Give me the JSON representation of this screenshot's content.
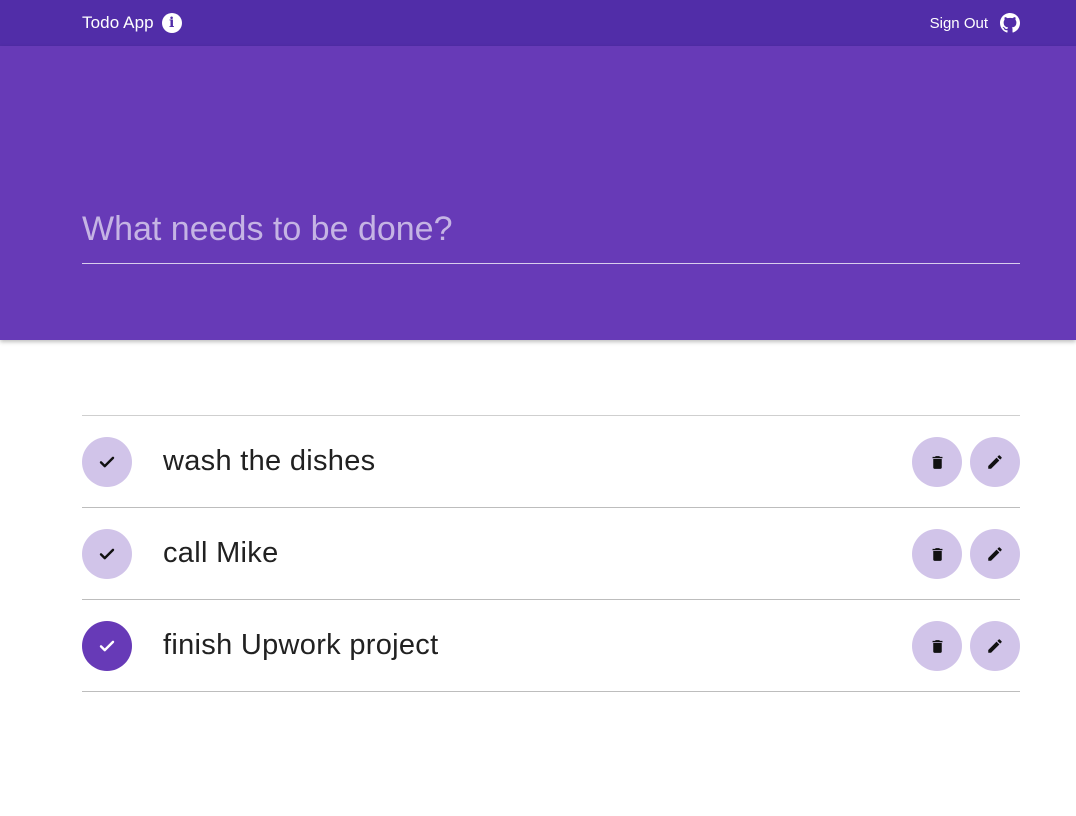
{
  "header": {
    "title": "Todo App",
    "info_icon": "info-icon",
    "sign_out_label": "Sign Out",
    "github_icon": "github-icon",
    "bar_color": "#512da8"
  },
  "hero": {
    "input_placeholder": "What needs to be done?",
    "input_value": "",
    "color": "#673ab7"
  },
  "todos": [
    {
      "text": "wash the dishes",
      "completed": false
    },
    {
      "text": "call Mike",
      "completed": false
    },
    {
      "text": "finish Upwork project",
      "completed": true
    }
  ],
  "icons": {
    "complete": "check-icon",
    "delete": "trash-icon",
    "edit": "pencil-icon"
  },
  "colors": {
    "accent_light": "#d1c4e9",
    "accent": "#673ab7",
    "text": "#212121"
  }
}
